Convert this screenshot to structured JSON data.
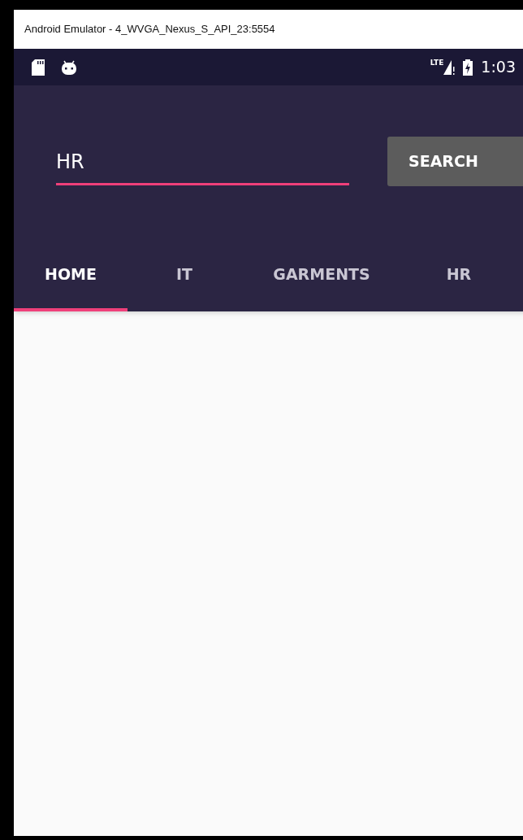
{
  "window": {
    "title": "Android Emulator - 4_WVGA_Nexus_S_API_23:5554"
  },
  "status_bar": {
    "network": "LTE",
    "time": "1:03"
  },
  "search": {
    "value": "HR",
    "button": "SEARCH"
  },
  "tabs": [
    {
      "label": "HOME",
      "selected": true
    },
    {
      "label": "IT",
      "selected": false
    },
    {
      "label": "GARMENTS",
      "selected": false
    },
    {
      "label": "HR",
      "selected": false
    }
  ]
}
